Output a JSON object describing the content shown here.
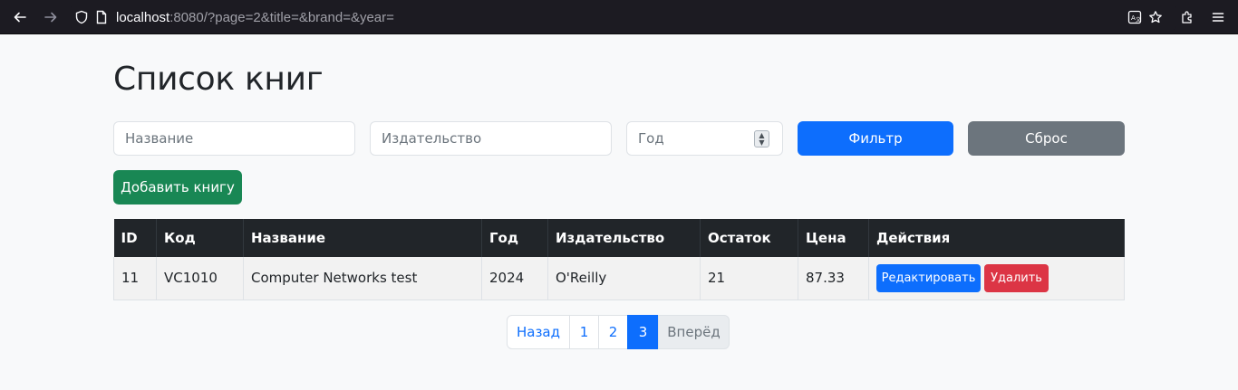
{
  "browser": {
    "url_host": "localhost",
    "url_rest": ":8080/?page=2&title=&brand=&year="
  },
  "page": {
    "title": "Список книг"
  },
  "filters": {
    "title_placeholder": "Название",
    "publisher_placeholder": "Издательство",
    "year_placeholder": "Год",
    "filter_label": "Фильтр",
    "reset_label": "Сброс"
  },
  "add_button_label": "Добавить книгу",
  "table": {
    "headers": [
      "ID",
      "Код",
      "Название",
      "Год",
      "Издательство",
      "Остаток",
      "Цена",
      "Действия"
    ],
    "rows": [
      {
        "id": "11",
        "code": "VC1010",
        "name": "Computer Networks test",
        "year": "2024",
        "publisher": "O'Reilly",
        "stock": "21",
        "price": "87.33",
        "edit_label": "Редактировать",
        "delete_label": "Удалить"
      }
    ]
  },
  "pagination": {
    "prev_label": "Назад",
    "pages": [
      "1",
      "2",
      "3"
    ],
    "active_page": "3",
    "next_label": "Вперёд"
  },
  "colors": {
    "primary": "#0d6efd",
    "secondary": "#6c757d",
    "success": "#198754",
    "danger": "#dc3545",
    "table_header": "#212529"
  }
}
